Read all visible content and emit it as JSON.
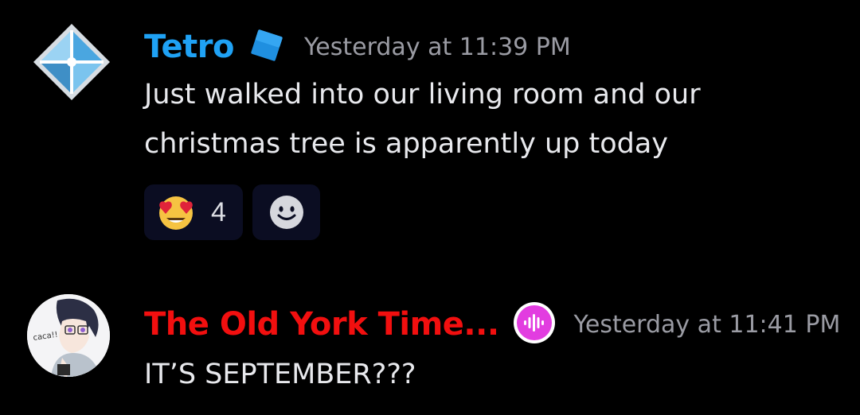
{
  "colors": {
    "tetro_name": "#1fa2f5",
    "oldyork_name": "#f20f0f",
    "timestamp": "#9a9ba3",
    "text": "#e8e9ed",
    "reaction_bg": "#0b0d22"
  },
  "messages": [
    {
      "author": "Tetro",
      "avatar_icon": "blue-diamond-icon",
      "badge_icon": "blue-square-badge-icon",
      "timestamp": "Yesterday at 11:39 PM",
      "lines": [
        "Just walked into our living room and our",
        "christmas tree is apparently up today"
      ],
      "reactions": [
        {
          "emoji": "heart-eyes-emoji-icon",
          "count": "4"
        },
        {
          "emoji": "add-reaction-smiley-icon"
        }
      ]
    },
    {
      "author": "The Old York Time...",
      "avatar_icon": "anime-character-avatar",
      "badge_icon": "audio-waveform-badge-icon",
      "timestamp": "Yesterday at 11:41 PM",
      "lines": [
        "IT’S SEPTEMBER???"
      ]
    }
  ]
}
